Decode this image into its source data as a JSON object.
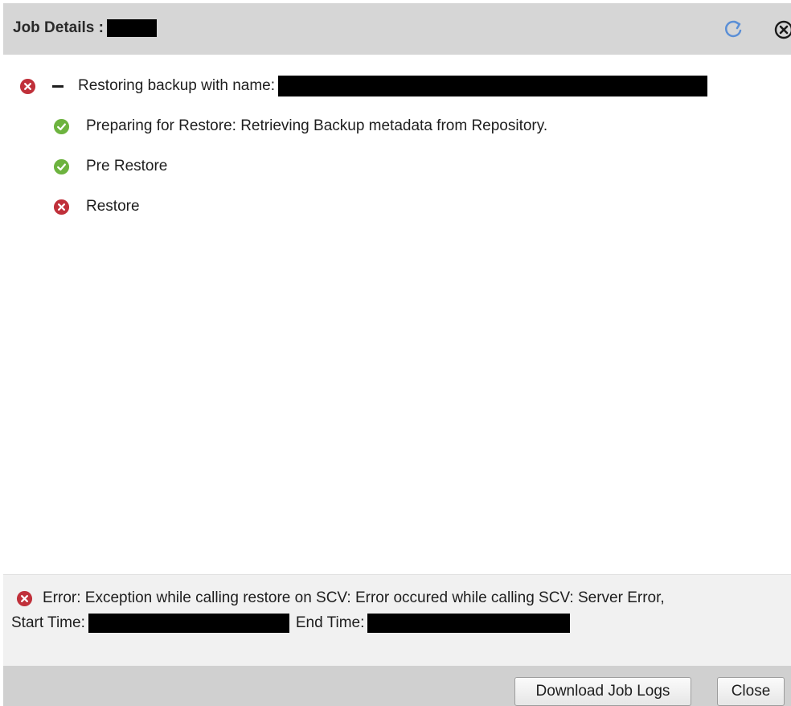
{
  "header": {
    "title": "Job Details :"
  },
  "tree": {
    "root": {
      "status": "error",
      "label": "Restoring backup with name:"
    },
    "children": [
      {
        "status": "success",
        "label": "Preparing for Restore: Retrieving Backup metadata from Repository."
      },
      {
        "status": "success",
        "label": "Pre Restore"
      },
      {
        "status": "error",
        "label": "Restore"
      }
    ]
  },
  "error_panel": {
    "message": "Error: Exception while calling restore on SCV: Error occured while calling SCV: Server Error,",
    "start_label": "Start Time:",
    "end_label": "End Time:"
  },
  "footer": {
    "download_label": "Download Job Logs",
    "close_label": "Close"
  },
  "colors": {
    "error": "#c0303a",
    "success": "#6db33f",
    "refresh": "#5b8fd6",
    "header_bg": "#d6d6d6"
  },
  "icons": {
    "refresh": "refresh-icon",
    "close": "close-circle-icon",
    "error": "error-circle-icon",
    "success": "check-circle-icon"
  }
}
